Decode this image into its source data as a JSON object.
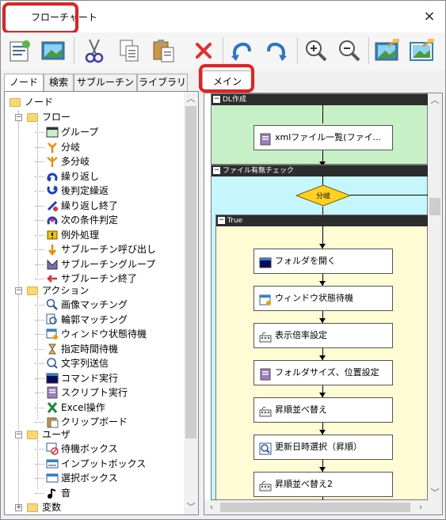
{
  "window": {
    "title": "フローチャート",
    "close_symbol": "×"
  },
  "toolbar": {
    "buttons": [
      {
        "name": "new-file-icon"
      },
      {
        "name": "image-icon"
      },
      {
        "name": "cut-icon"
      },
      {
        "name": "copy-icon"
      },
      {
        "name": "paste-icon"
      },
      {
        "name": "delete-icon"
      },
      {
        "name": "undo-icon"
      },
      {
        "name": "redo-icon"
      },
      {
        "name": "zoom-in-icon"
      },
      {
        "name": "zoom-out-icon"
      },
      {
        "name": "export-icon"
      },
      {
        "name": "import-icon"
      }
    ]
  },
  "left_tabs": [
    "ノード",
    "検索",
    "サブルーチン",
    "ライブラリ"
  ],
  "tree": {
    "root": "ノード",
    "flow": {
      "label": "フロー",
      "items": [
        "グループ",
        "分岐",
        "多分岐",
        "繰り返し",
        "後判定繰返",
        "繰り返し終了",
        "次の条件判定",
        "例外処理",
        "サブルーチン呼び出し",
        "サブルーチングループ",
        "サブルーチン終了"
      ]
    },
    "action": {
      "label": "アクション",
      "items": [
        "画像マッチング",
        "輪郭マッチング",
        "ウィンドウ状態待機",
        "指定時間待機",
        "文字列送信",
        "コマンド実行",
        "スクリプト実行",
        "Excel操作",
        "クリップボード"
      ]
    },
    "user": {
      "label": "ユーザ",
      "items": [
        "待機ボックス",
        "インプットボックス",
        "選択ボックス",
        "音"
      ]
    },
    "variable": {
      "label": "変数"
    }
  },
  "right_tab": "メイン",
  "canvas": {
    "group_dl": "DL作成",
    "node_xml": "xmlファイル一覧(ファイ...",
    "group_check": "ファイル有無チェック",
    "branch": "分岐",
    "group_true": "True",
    "actions": [
      "フォルダを開く",
      "ウィンドウ状態待機",
      "表示倍率設定",
      "フォルダサイズ、位置設定",
      "昇順並べ替え",
      "更新日時選択（昇順）",
      "昇順並べ替え2"
    ]
  },
  "colors": {
    "highlight": "#ee1c1c",
    "branch_fill": "#ffd21f",
    "true_bg": "#fffbd5",
    "check_bg": "#c4f6fb",
    "flow_bg": "#c7f0c7"
  }
}
